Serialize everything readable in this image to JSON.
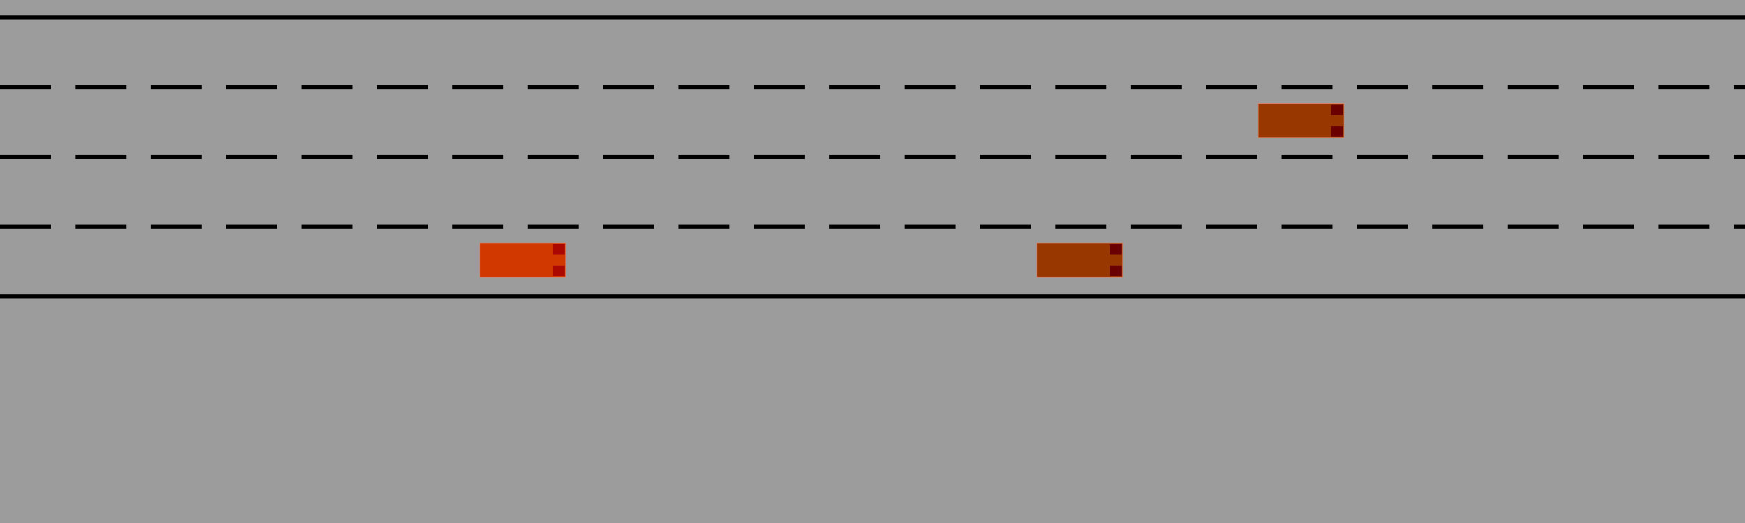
{
  "road": {
    "lanes": 4,
    "background_color": "#9c9c9c",
    "line_color": "#000000"
  },
  "cars": [
    {
      "role": "player",
      "lane": 4,
      "body_color": "#d03800",
      "light_color": "#aa0800"
    },
    {
      "role": "traffic",
      "lane": 4,
      "body_color": "#993700",
      "light_color": "#6b0000"
    },
    {
      "role": "traffic",
      "lane": 2,
      "body_color": "#993700",
      "light_color": "#6b0000"
    }
  ]
}
